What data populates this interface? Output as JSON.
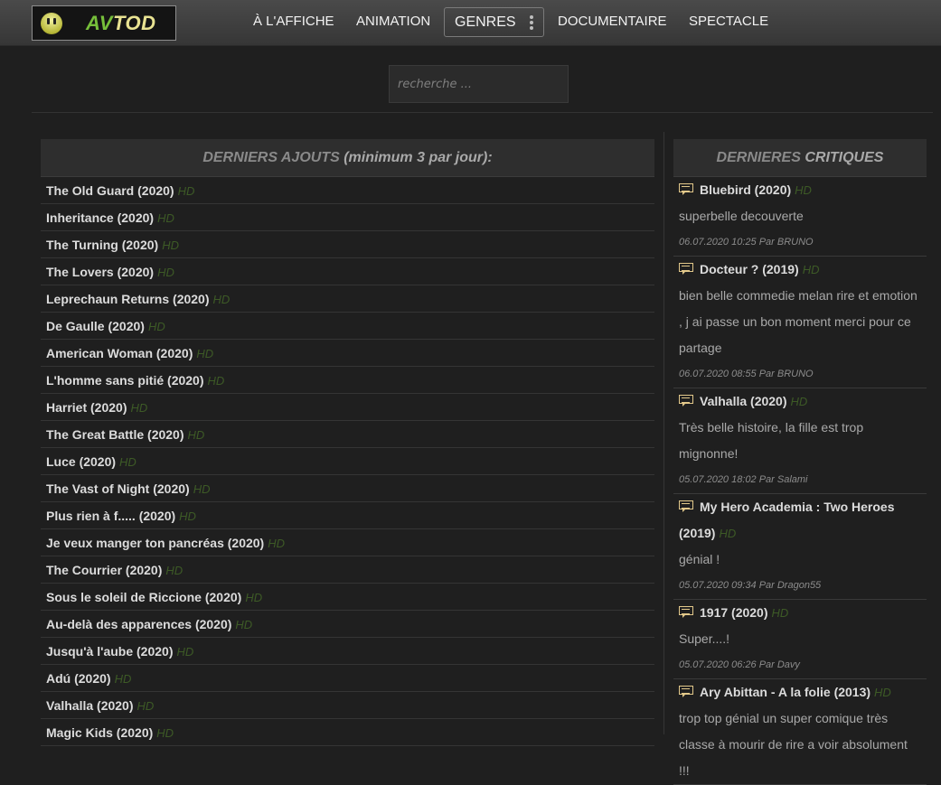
{
  "header": {
    "logo": {
      "part1": "AV",
      "part2": "TOD"
    },
    "nav": {
      "affiche": "À L'AFFICHE",
      "animation": "ANIMATION",
      "genres": "GENRES",
      "documentaire": "DOCUMENTAIRE",
      "spectacle": "SPECTACLE"
    }
  },
  "search": {
    "placeholder": "recherche ..."
  },
  "latest": {
    "heading_part1": "DERNIERS ",
    "heading_part2": "AJOUTS",
    "heading_part3": " (minimum 3 par jour):",
    "hd_badge": "HD",
    "items": [
      "The Old Guard (2020)",
      "Inheritance (2020)",
      "The Turning (2020)",
      "The Lovers (2020)",
      "Leprechaun Returns (2020)",
      "De Gaulle (2020)",
      "American Woman (2020)",
      "L'homme sans pitié (2020)",
      "Harriet (2020)",
      "The Great Battle (2020)",
      "Luce (2020)",
      "The Vast of Night (2020)",
      "Plus rien à f..... (2020)",
      "Je veux manger ton pancréas (2020)",
      "The Courrier (2020)",
      "Sous le soleil de Riccione (2020)",
      "Au-delà des apparences (2020)",
      "Jusqu'à l'aube (2020)",
      "Adú (2020)",
      "Valhalla (2020)",
      "Magic Kids (2020)"
    ]
  },
  "critiques": {
    "heading_part1": "DERNIERES ",
    "heading_part2": "CRITIQUES",
    "items": [
      {
        "title": "Bluebird (2020)",
        "hd": "HD",
        "text": "superbelle decouverte",
        "meta": "06.07.2020 10:25 Par BRUNO"
      },
      {
        "title": "Docteur ? (2019)",
        "hd": "HD",
        "text": "bien belle commedie melan rire et emotion , j ai passe un bon moment merci pour ce partage",
        "meta": "06.07.2020 08:55 Par BRUNO"
      },
      {
        "title": "Valhalla (2020)",
        "hd": "HD",
        "text": "Très belle histoire, la fille est trop mignonne!",
        "meta": "05.07.2020 18:02 Par Salami"
      },
      {
        "title": "My Hero Academia : Two Heroes (2019)",
        "hd": "HD",
        "text": "génial !",
        "meta": "05.07.2020 09:34 Par Dragon55"
      },
      {
        "title": "1917 (2020)",
        "hd": "HD",
        "text": "Super....!",
        "meta": "05.07.2020 06:26 Par Davy"
      },
      {
        "title": "Ary Abittan - A la folie (2013)",
        "hd": "HD",
        "text": "trop top génial un super comique très classe à mourir de rire a voir absolument !!!",
        "meta": ""
      }
    ]
  }
}
